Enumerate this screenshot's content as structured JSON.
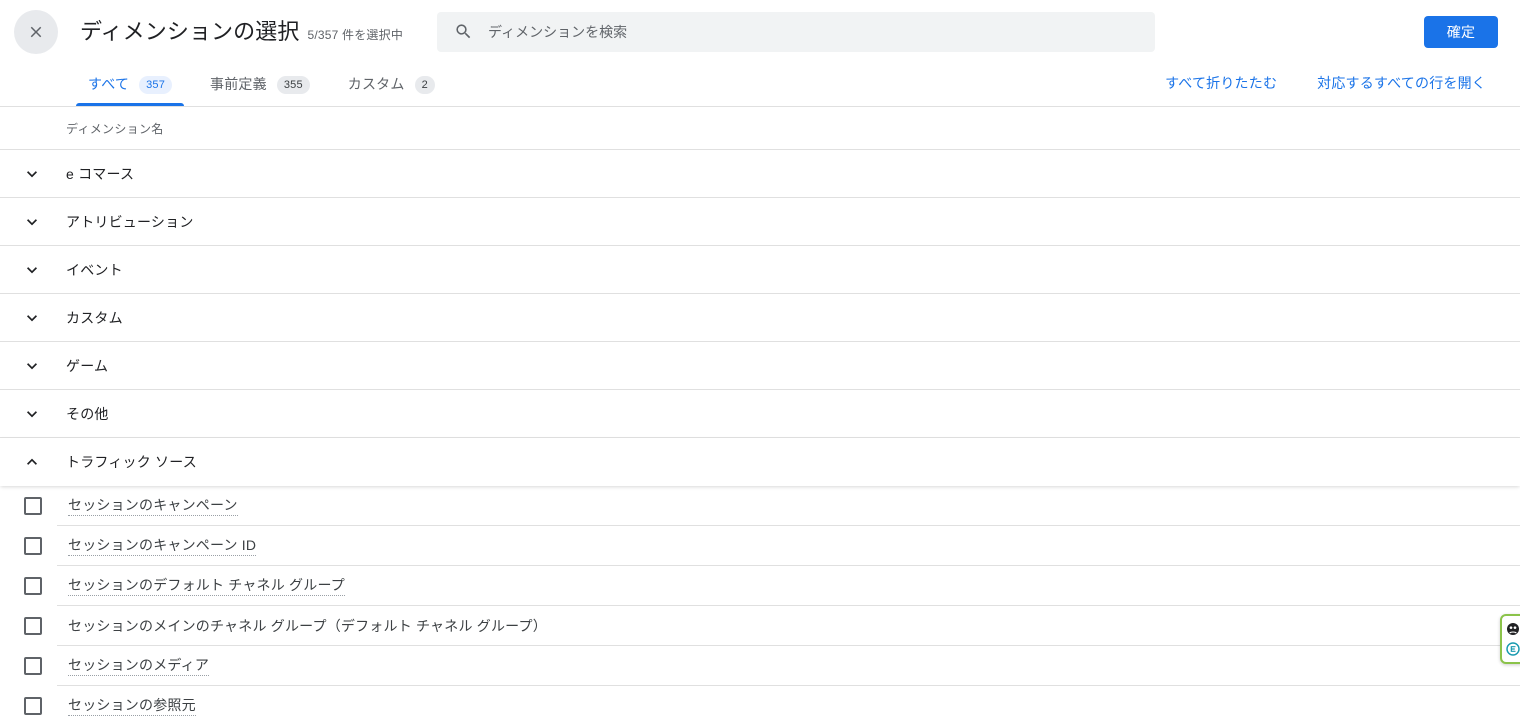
{
  "header": {
    "close_icon": "close-icon",
    "title": "ディメンションの選択",
    "selected_count": "5/357 件を選択中",
    "search": {
      "icon": "search-icon",
      "placeholder": "ディメンションを検索",
      "value": ""
    },
    "confirm_label": "確定"
  },
  "tabs": [
    {
      "label": "すべて",
      "badge": "357",
      "active": true
    },
    {
      "label": "事前定義",
      "badge": "355",
      "active": false
    },
    {
      "label": "カスタム",
      "badge": "2",
      "active": false
    }
  ],
  "tab_actions": {
    "collapse_all": "すべて折りたたむ",
    "expand_all": "対応するすべての行を開く"
  },
  "table": {
    "column_header": "ディメンション名",
    "groups": [
      {
        "label": "e コマース",
        "expanded": false,
        "icon": "chevron-down-icon"
      },
      {
        "label": "アトリビューション",
        "expanded": false,
        "icon": "chevron-down-icon"
      },
      {
        "label": "イベント",
        "expanded": false,
        "icon": "chevron-down-icon"
      },
      {
        "label": "カスタム",
        "expanded": false,
        "icon": "chevron-down-icon"
      },
      {
        "label": "ゲーム",
        "expanded": false,
        "icon": "chevron-down-icon"
      },
      {
        "label": "その他",
        "expanded": false,
        "icon": "chevron-down-icon"
      },
      {
        "label": "トラフィック ソース",
        "expanded": true,
        "icon": "chevron-up-icon"
      }
    ],
    "items": [
      {
        "label": "セッションのキャンペーン",
        "checked": false,
        "tooltip_underline": true
      },
      {
        "label": "セッションのキャンペーン ID",
        "checked": false,
        "tooltip_underline": true
      },
      {
        "label": "セッションのデフォルト チャネル グループ",
        "checked": false,
        "tooltip_underline": true
      },
      {
        "label": "セッションのメインのチャネル グループ（デフォルト チャネル グループ）",
        "checked": false,
        "tooltip_underline": false
      },
      {
        "label": "セッションのメディア",
        "checked": false,
        "tooltip_underline": true
      },
      {
        "label": "セッションの参照元",
        "checked": false,
        "tooltip_underline": true
      }
    ]
  },
  "extension_widget": {
    "border_color": "#8bc34a",
    "icons": [
      "bug-icon",
      "circle-e-icon"
    ]
  },
  "colors": {
    "accent": "#1a73e8",
    "badge_active_bg": "#e8f0fe",
    "badge_bg": "#e8eaed",
    "search_bg": "#f1f3f4",
    "divider": "#e0e0e0",
    "text_primary": "#202124",
    "text_secondary": "#5f6368"
  }
}
